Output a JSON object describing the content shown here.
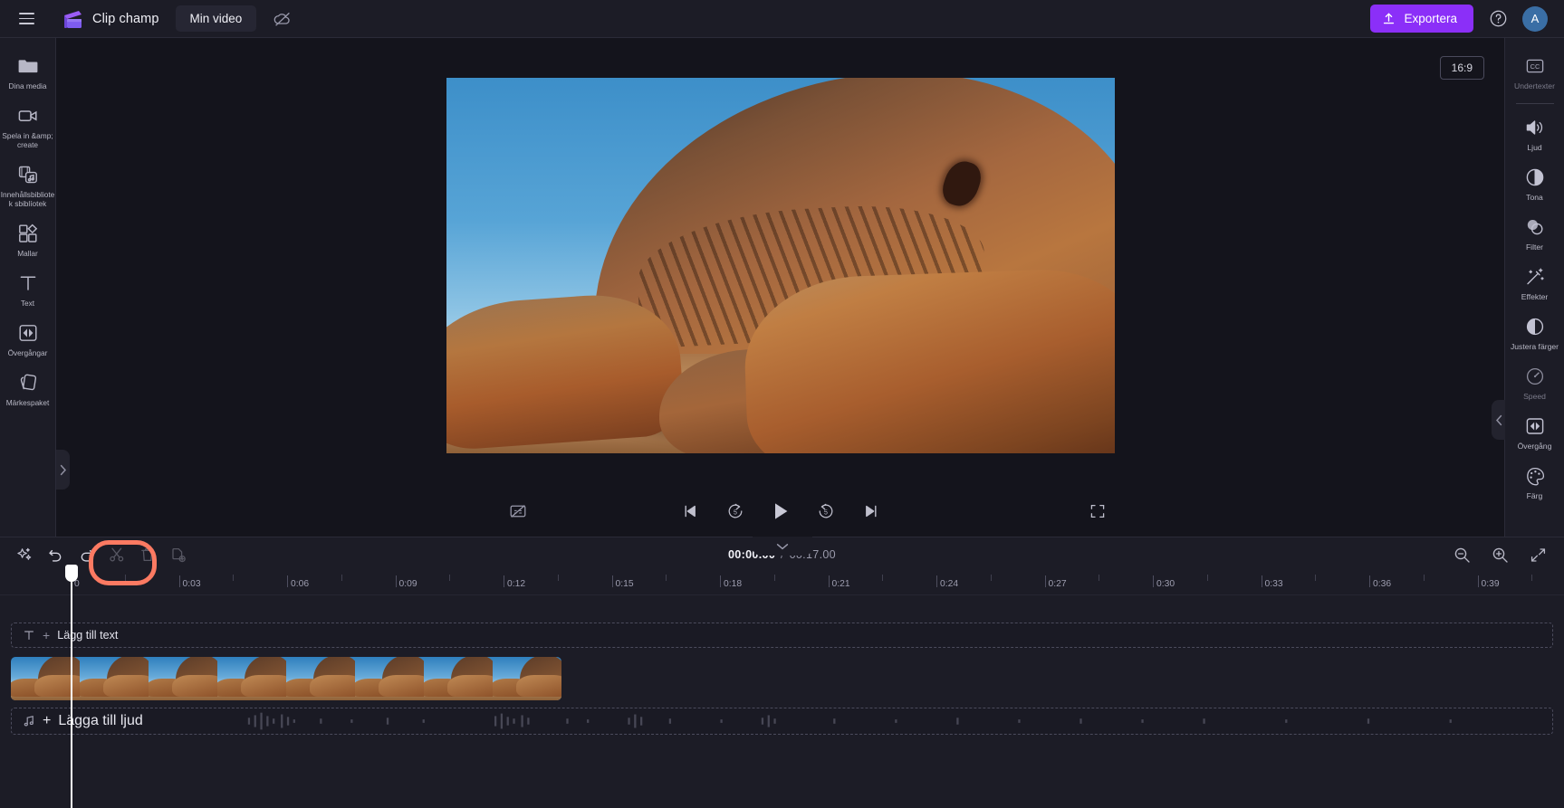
{
  "app": {
    "brand_name": "Clip champ",
    "project_title": "Min video",
    "menu_icon": "hamburger-icon",
    "cloud_icon": "cloud-off-icon"
  },
  "topbar": {
    "export_label": "Exportera",
    "help_icon": "help-icon",
    "avatar_initial": "A",
    "accent_color": "#8b2ff8"
  },
  "left_sidebar": {
    "items": [
      {
        "label": "Dina media",
        "icon": "folder-icon",
        "dim": false
      },
      {
        "label": "Spela in &amp;\ncreate",
        "icon": "record-video-icon",
        "dim": false
      },
      {
        "label": "Innehållsbibliotek\nsbiblíotek",
        "icon": "content-library-icon",
        "dim": false
      },
      {
        "label": "Mallar",
        "icon": "templates-icon",
        "dim": false
      },
      {
        "label": "Text",
        "icon": "text-icon",
        "dim": false
      },
      {
        "label": "Övergångar",
        "icon": "transitions-icon",
        "dim": false
      },
      {
        "label": "Märkespaket",
        "icon": "brand-kit-icon",
        "dim": false
      }
    ],
    "collapse_icon": "chevron-right-icon"
  },
  "right_sidebar": {
    "items": [
      {
        "label": "Undertexter",
        "icon": "captions-icon",
        "dim": true,
        "separator_after": true
      },
      {
        "label": "Ljud",
        "icon": "audio-icon",
        "dim": false,
        "separator_after": false
      },
      {
        "label": "Tona",
        "icon": "fade-icon",
        "dim": false,
        "separator_after": false
      },
      {
        "label": "Filter",
        "icon": "filter-icon",
        "dim": false,
        "separator_after": false
      },
      {
        "label": "Effekter",
        "icon": "effects-icon",
        "dim": false,
        "separator_after": false
      },
      {
        "label": "Justera\nfärger",
        "icon": "adjust-colors-icon",
        "dim": false,
        "separator_after": false
      },
      {
        "label": "Speed",
        "icon": "speed-icon",
        "dim": true,
        "separator_after": false
      },
      {
        "label": "Övergång",
        "icon": "transition-icon",
        "dim": false,
        "separator_after": false
      },
      {
        "label": "Färg",
        "icon": "color-icon",
        "dim": false,
        "separator_after": false
      }
    ],
    "collapse_icon": "chevron-left-icon"
  },
  "preview": {
    "aspect_ratio": "16:9",
    "captions_toggle_icon": "captions-off-icon",
    "fullscreen_icon": "fullscreen-icon",
    "controls": [
      {
        "name": "skip-to-start",
        "icon": "skip-start-icon"
      },
      {
        "name": "back-5-seconds",
        "icon": "rewind-5-icon"
      },
      {
        "name": "play",
        "icon": "play-icon"
      },
      {
        "name": "forward-5-seconds",
        "icon": "forward-5-icon"
      },
      {
        "name": "skip-to-end",
        "icon": "skip-end-icon"
      }
    ]
  },
  "timeline": {
    "toolbar": [
      {
        "name": "magic-tools",
        "icon": "sparkle-icon",
        "disabled": false
      },
      {
        "name": "undo",
        "icon": "undo-icon",
        "disabled": false
      },
      {
        "name": "redo",
        "icon": "redo-icon",
        "disabled": false
      },
      {
        "name": "split",
        "icon": "scissors-icon",
        "disabled": true
      },
      {
        "name": "delete",
        "icon": "trash-icon",
        "disabled": true
      },
      {
        "name": "duplicate",
        "icon": "duplicate-icon",
        "disabled": true
      }
    ],
    "current_time": "00:00.00",
    "time_separator": "/",
    "total_time": "00:17.00",
    "zoom_controls": [
      {
        "name": "zoom-out",
        "icon": "zoom-out-icon"
      },
      {
        "name": "zoom-in",
        "icon": "zoom-in-icon"
      },
      {
        "name": "fit-to-screen",
        "icon": "fit-screen-icon"
      }
    ],
    "collapse_handle_icon": "chevron-down-icon",
    "ruler_labels": [
      "0",
      "0:03",
      "0:06",
      "0:09",
      "0:12",
      "0:15",
      "0:18",
      "0:21",
      "0:24",
      "0:27",
      "0:30",
      "0:33",
      "0:36",
      "0:39"
    ],
    "text_track": {
      "label": "Lägg till text",
      "icon": "text-track-icon",
      "plus": "+"
    },
    "audio_track": {
      "label": "Lägga till ljud",
      "icon": "music-note-icon",
      "plus": "+"
    },
    "video_clip": {
      "thumbnail_count": 8
    }
  },
  "annotation": {
    "color": "#fc7a62",
    "target": "undo-redo-buttons"
  }
}
